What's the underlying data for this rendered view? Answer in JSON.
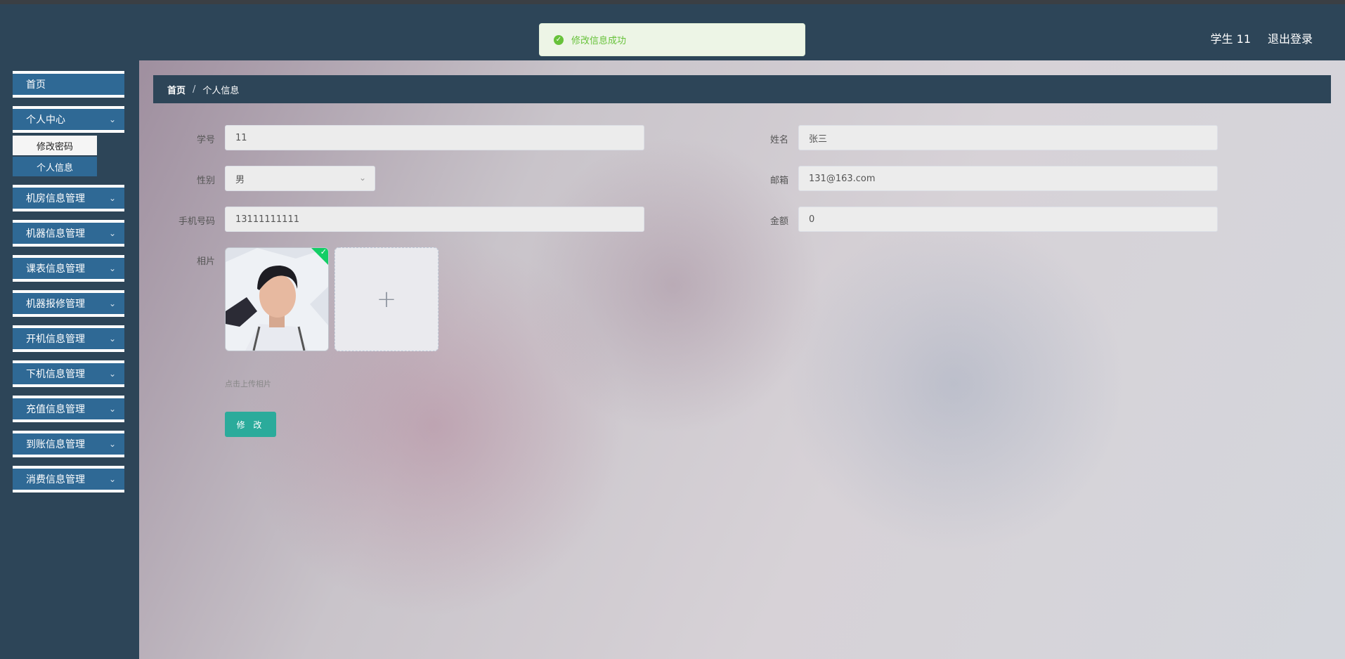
{
  "toast": {
    "text": "修改信息成功"
  },
  "header": {
    "user": "学生 11",
    "logout": "退出登录"
  },
  "sidebar": {
    "items": [
      {
        "label": "首页"
      },
      {
        "label": "个人中心"
      },
      {
        "label": "机房信息管理"
      },
      {
        "label": "机器信息管理"
      },
      {
        "label": "课表信息管理"
      },
      {
        "label": "机器报修管理"
      },
      {
        "label": "开机信息管理"
      },
      {
        "label": "下机信息管理"
      },
      {
        "label": "充值信息管理"
      },
      {
        "label": "到账信息管理"
      },
      {
        "label": "消费信息管理"
      }
    ],
    "submenu": [
      {
        "label": "修改密码"
      },
      {
        "label": "个人信息"
      }
    ]
  },
  "breadcrumb": {
    "home": "首页",
    "separator": "/",
    "current": "个人信息"
  },
  "form": {
    "student_id": {
      "label": "学号",
      "value": "11"
    },
    "name": {
      "label": "姓名",
      "value": "张三"
    },
    "gender": {
      "label": "性别",
      "value": "男"
    },
    "email": {
      "label": "邮箱",
      "value": "131@163.com"
    },
    "phone": {
      "label": "手机号码",
      "value": "13111111111"
    },
    "balance": {
      "label": "金额",
      "value": "0"
    },
    "photo": {
      "label": "相片",
      "hint": "点击上传相片"
    },
    "submit": "修 改"
  }
}
